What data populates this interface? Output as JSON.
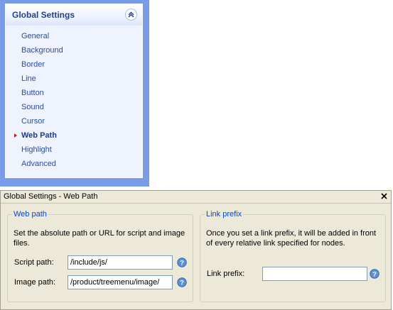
{
  "nav": {
    "title": "Global Settings",
    "items": [
      {
        "label": "General"
      },
      {
        "label": "Background"
      },
      {
        "label": "Border"
      },
      {
        "label": "Line"
      },
      {
        "label": "Button"
      },
      {
        "label": "Sound"
      },
      {
        "label": "Cursor"
      },
      {
        "label": "Web Path",
        "active": true
      },
      {
        "label": "Highlight"
      },
      {
        "label": "Advanced"
      }
    ],
    "collapse_icon": "double-chevron-up-icon"
  },
  "dialog": {
    "title": "Global Settings - Web Path",
    "close_icon": "close-x-icon",
    "web_path": {
      "legend": "Web path",
      "description_line1": "Set the absolute path or URL for script and image",
      "description_line2": "files.",
      "script_label": "Script path:",
      "script_value": "/include/js/",
      "image_label": "Image path:",
      "image_value": "/product/treemenu/image/"
    },
    "link_prefix": {
      "legend": "Link prefix",
      "description_line1": "Once you set a link prefix, it will be added in front",
      "description_line2": "of every relative link specified for nodes.",
      "prefix_label": "Link prefix:",
      "prefix_value": ""
    },
    "help_icon": "question-mark-help-icon"
  },
  "colors": {
    "nav_background": "#7a9be8",
    "link_text": "#2a4ca0",
    "legend_text": "#0046d5",
    "dialog_background": "#ece9d8"
  }
}
